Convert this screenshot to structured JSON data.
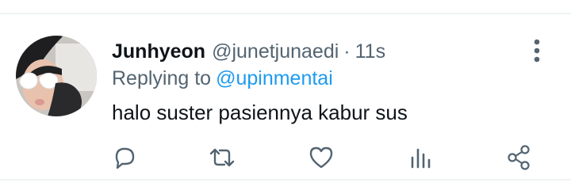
{
  "tweet": {
    "display_name": "Junhyeon",
    "handle": "@junetjunaedi",
    "separator": "·",
    "time": "11s",
    "replying_prefix": "Replying to",
    "replying_handle": "@upinmentai",
    "text": "halo suster pasiennya kabur sus"
  },
  "icons": {
    "more": "more-vertical-icon",
    "reply": "reply-icon",
    "retweet": "retweet-icon",
    "like": "heart-icon",
    "views": "analytics-icon",
    "share": "share-icon"
  },
  "colors": {
    "text_primary": "#0f1419",
    "text_secondary": "#536471",
    "link": "#1d9bf0",
    "divider": "#eff3f4"
  }
}
